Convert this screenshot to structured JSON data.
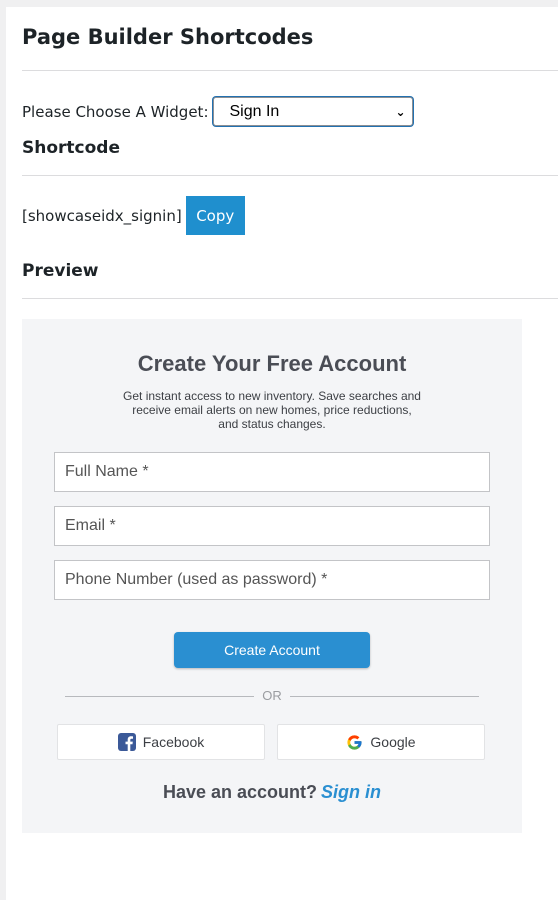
{
  "page": {
    "title": "Page Builder Shortcodes"
  },
  "widget_selector": {
    "label": "Please Choose A Widget:",
    "selected": "Sign In"
  },
  "shortcode_section": {
    "heading": "Shortcode",
    "code": "[showcaseidx_signin]",
    "copy_label": "Copy"
  },
  "preview_section": {
    "heading": "Preview"
  },
  "signup_form": {
    "title": "Create Your Free Account",
    "description": "Get instant access to new inventory. Save searches and receive email alerts on new homes, price reductions, and status changes.",
    "fields": {
      "full_name": "Full Name *",
      "email": "Email *",
      "phone": "Phone Number (used as password) *"
    },
    "submit_label": "Create Account",
    "divider_text": "OR",
    "social": {
      "facebook": "Facebook",
      "google": "Google"
    },
    "have_account_text": "Have an account?",
    "sign_in_link": "Sign in"
  },
  "colors": {
    "accent": "#2a8fd1",
    "copy_button": "#1f8fce",
    "facebook": "#3b5998",
    "preview_background": "#f4f5f7"
  },
  "icons": {
    "select_arrow": "chevron-down-icon",
    "facebook": "facebook-icon",
    "google": "google-icon"
  }
}
